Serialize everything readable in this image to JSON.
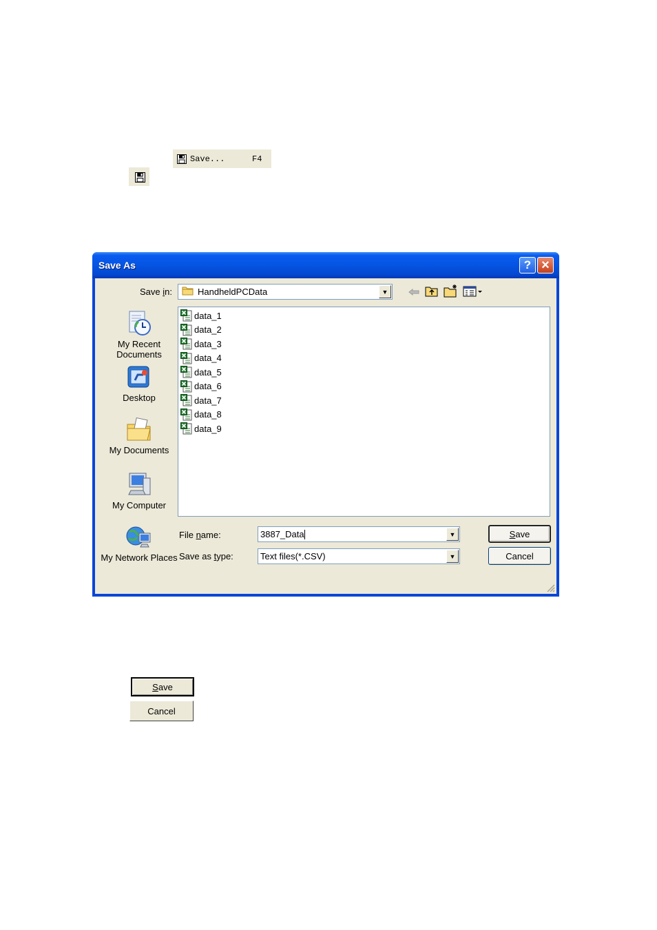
{
  "menu_snippet": {
    "label": "Save...",
    "shortcut": "F4",
    "icon": "floppy-disk-icon"
  },
  "toolbar_snippet": {
    "icon": "floppy-disk-icon"
  },
  "dialog": {
    "title": "Save As",
    "help_icon": "?",
    "close_icon": "×",
    "save_in": {
      "label_pre": "Save ",
      "label_key": "i",
      "label_post": "n:",
      "value": "HandheldPCData"
    },
    "toolbar_icons": [
      "back-icon",
      "up-folder-icon",
      "new-folder-icon",
      "views-menu-icon"
    ],
    "places": [
      {
        "label": "My Recent Documents",
        "icon": "recent-documents-icon"
      },
      {
        "label": "Desktop",
        "icon": "desktop-icon"
      },
      {
        "label": "My Documents",
        "icon": "my-documents-icon"
      },
      {
        "label": "My Computer",
        "icon": "my-computer-icon"
      },
      {
        "label": "My Network Places",
        "icon": "network-places-icon"
      }
    ],
    "files": [
      "data_1",
      "data_2",
      "data_3",
      "data_4",
      "data_5",
      "data_6",
      "data_7",
      "data_8",
      "data_9"
    ],
    "file_name": {
      "label_pre": "File ",
      "label_key": "n",
      "label_post": "ame:",
      "value": "3887_Data"
    },
    "save_as_type": {
      "label_pre": "Save as ",
      "label_key": "t",
      "label_post": "ype:",
      "value": "Text files(*.CSV)"
    },
    "save_button": {
      "key": "S",
      "rest": "ave"
    },
    "cancel_button": "Cancel"
  },
  "standalone_buttons": {
    "save": {
      "key": "S",
      "rest": "ave"
    },
    "cancel": "Cancel"
  }
}
